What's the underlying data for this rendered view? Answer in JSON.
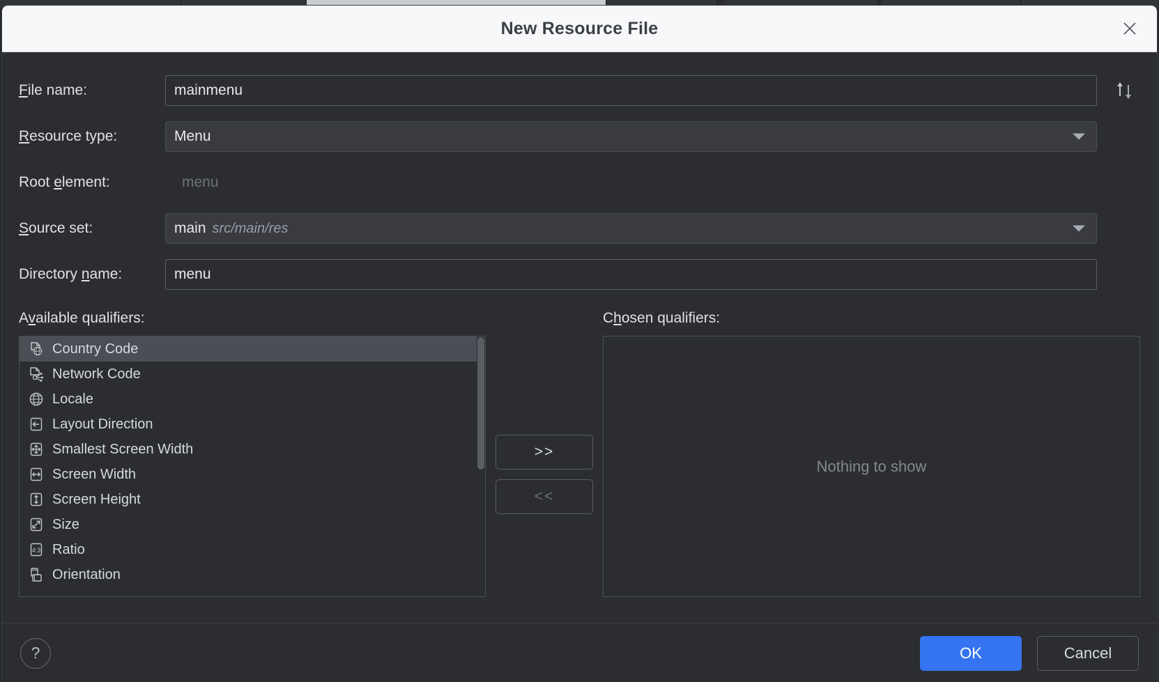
{
  "window": {
    "title": "New Resource File",
    "close_icon": "close-icon"
  },
  "form": {
    "file_name": {
      "label_pre": "F",
      "label_post": "ile name:",
      "value": "mainmenu",
      "sort_icon": "sort-updown-icon"
    },
    "resource_type": {
      "label_pre": "R",
      "label_post": "esource type:",
      "value": "Menu",
      "caret_icon": "chevron-down-icon"
    },
    "root_element": {
      "label_a": "Root ",
      "label_pre": "e",
      "label_post": "lement:",
      "value": "menu"
    },
    "source_set": {
      "label_pre": "S",
      "label_post": "ource set:",
      "value": "main",
      "path": "src/main/res",
      "caret_icon": "chevron-down-icon"
    },
    "directory_name": {
      "label_a": "Directory ",
      "label_pre": "n",
      "label_post": "ame:",
      "value": "menu"
    }
  },
  "qualifiers": {
    "available_label_a": "A",
    "available_label_pre": "v",
    "available_label_post": "ailable qualifiers:",
    "chosen_label_a": "C",
    "chosen_label_pre": "h",
    "chosen_label_post": "osen qualifiers:",
    "available": [
      {
        "label": "Country Code",
        "icon": "file-globe-icon",
        "selected": true
      },
      {
        "label": "Network Code",
        "icon": "file-network-icon",
        "selected": false
      },
      {
        "label": "Locale",
        "icon": "globe-icon",
        "selected": false
      },
      {
        "label": "Layout Direction",
        "icon": "arrow-left-box-icon",
        "selected": false
      },
      {
        "label": "Smallest Screen Width",
        "icon": "arrows-four-box-icon",
        "selected": false
      },
      {
        "label": "Screen Width",
        "icon": "arrows-horizontal-box-icon",
        "selected": false
      },
      {
        "label": "Screen Height",
        "icon": "arrows-vertical-box-icon",
        "selected": false
      },
      {
        "label": "Size",
        "icon": "arrow-diagonal-box-icon",
        "selected": false
      },
      {
        "label": "Ratio",
        "icon": "ratio-box-icon",
        "selected": false
      },
      {
        "label": "Orientation",
        "icon": "orientation-icon",
        "selected": false
      }
    ],
    "chosen_empty_text": "Nothing to show",
    "add_button": ">>",
    "remove_button": "<<"
  },
  "footer": {
    "help_label": "?",
    "ok_label": "OK",
    "cancel_label": "Cancel"
  },
  "colors": {
    "accent": "#3574f0",
    "dialog_bg": "#2b2d30",
    "titlebar_bg": "#f7f8fa",
    "selection": "#4b4e55"
  }
}
